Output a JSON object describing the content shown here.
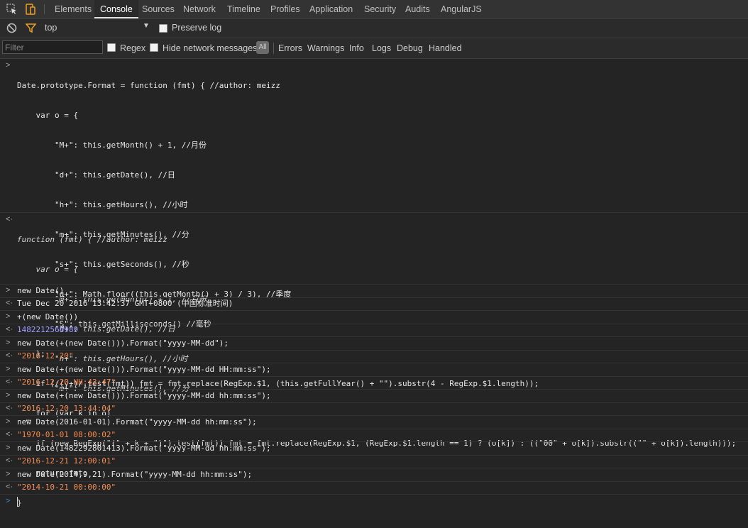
{
  "tabs": [
    "Elements",
    "Console",
    "Sources",
    "Network",
    "Timeline",
    "Profiles",
    "Application",
    "Security",
    "Audits",
    "AngularJS"
  ],
  "toolbar": {
    "context": "top",
    "preserve_log": "Preserve log"
  },
  "filterbar": {
    "placeholder": "Filter",
    "regex": "Regex",
    "hide_network": "Hide network messages",
    "all": "All",
    "levels": [
      "Errors",
      "Warnings",
      "Info",
      "Logs",
      "Debug",
      "Handled"
    ]
  },
  "console": {
    "def_lines": [
      "Date.prototype.Format = function (fmt) { //author: meizz",
      "    var o = {",
      "        \"M+\": this.getMonth() + 1, //月份",
      "        \"d+\": this.getDate(), //日",
      "        \"h+\": this.getHours(), //小时",
      "        \"m+\": this.getMinutes(), //分",
      "        \"s+\": this.getSeconds(), //秒",
      "        \"q+\": Math.floor((this.getMonth() + 3) / 3), //季度",
      "        \"S\": this.getMilliseconds() //毫秒",
      "    };",
      "    if (/(y+)/.test(fmt)) fmt = fmt.replace(RegExp.$1, (this.getFullYear() + \"\").substr(4 - RegExp.$1.length));",
      "    for (var k in o)",
      "    if (new RegExp(\"(\" + k + \")\").test(fmt)) fmt = fmt.replace(RegExp.$1, (RegExp.$1.length == 1) ? (o[k]) : ((\"00\" + o[k]).substr((\"\" + o[k]).length)));",
      "    return fmt;",
      "}"
    ],
    "def_result": [
      "function (fmt) { //author: meizz",
      "    var o = {",
      "        \"M+\": this.getMonth() + 1, //月份",
      "        \"d+\": this.getDate(), //日",
      "        \"h+\": this.getHours(), //小时",
      "        \"m+\": this.getMinutes(), //分",
      "  …"
    ],
    "entries": [
      {
        "input": "new Date()",
        "output": "Tue Dec 20 2016 13:42:37 GMT+0800 (中国标准时间)"
      },
      {
        "input": "+(new Date())",
        "output": "1482212568989"
      },
      {
        "input": "new Date(+(new Date())).Format(\"yyyy-MM-dd\");",
        "output": "\"2016-12-20\""
      },
      {
        "input": "new Date(+(new Date())).Format(\"yyyy-MM-dd HH:mm:ss\");",
        "output": "\"2016-12-20 HH:43:47\""
      },
      {
        "input": "new Date(+(new Date())).Format(\"yyyy-MM-dd hh:mm:ss\");",
        "output": "\"2016-12-20 13:44:04\""
      },
      {
        "input": "new Date(2016-01-01).Format(\"yyyy-MM-dd hh:mm:ss\");",
        "output": "\"1970-01-01 08:00:02\""
      },
      {
        "input": "new Date(1482292801413).Format(\"yyyy-MM-dd hh:mm:ss\");",
        "output": "\"2016-12-21 12:00:01\""
      },
      {
        "input": "new Date(2014,9,21).Format(\"yyyy-MM-dd hh:mm:ss\");",
        "output": "\"2014-10-21 00:00:00\""
      }
    ]
  }
}
